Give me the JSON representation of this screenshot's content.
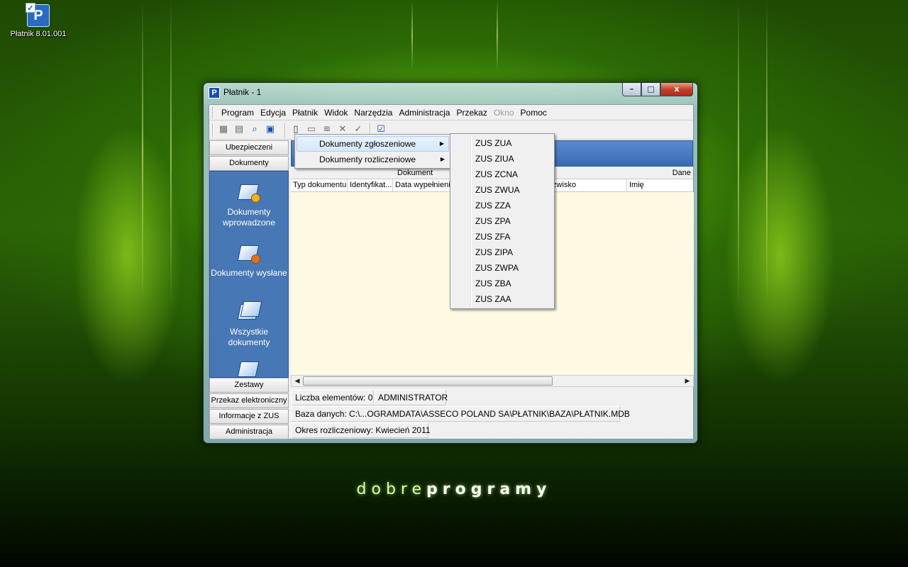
{
  "desktop": {
    "icon_label": "Płatnik 8.01.001",
    "brand_light": "dobre",
    "brand_bold": "programy"
  },
  "window": {
    "title": "Płatnik - 1",
    "controls": {
      "minimize": "–",
      "maximize": "□",
      "close": "x"
    }
  },
  "menu": [
    "Program",
    "Edycja",
    "Płatnik",
    "Widok",
    "Narzędzia",
    "Administracja",
    "Przekaz",
    "Okno",
    "Pomoc"
  ],
  "menu_disabled": "Okno",
  "nav": {
    "top_tabs": [
      "Ubezpieczeni",
      "Dokumenty"
    ],
    "items": [
      "Dokumenty wprowadzone",
      "Dokumenty wysłane",
      "Wszystkie dokumenty"
    ],
    "scroll_glyph": "▼",
    "bottom_tabs": [
      "Zestawy",
      "Przekaz elektroniczny",
      "Informacje z ZUS",
      "Administracja"
    ]
  },
  "grid": {
    "group_document": "Dokument",
    "group_data": "Dane",
    "columns": [
      "Typ dokumentu",
      "Identyfikat...",
      "Data wypełnienia",
      "",
      "Nazwisko",
      "Imię"
    ]
  },
  "status": {
    "count": "Liczba elementów: 0",
    "user": "ADMINISTRATOR",
    "database": "Baza danych: C:\\...OGRAMDATA\\ASSECO POLAND SA\\PŁATNIK\\BAZA\\PŁATNIK.MDB",
    "period": "Okres rozliczeniowy: Kwiecień 2011"
  },
  "context_menu": {
    "items": [
      "Dokumenty zgłoszeniowe",
      "Dokumenty rozliczeniowe"
    ],
    "arrow": "▶",
    "submenu": [
      "ZUS ZUA",
      "ZUS ZIUA",
      "ZUS ZCNA",
      "ZUS ZWUA",
      "ZUS ZZA",
      "ZUS ZPA",
      "ZUS ZFA",
      "ZUS ZIPA",
      "ZUS ZWPA",
      "ZUS ZBA",
      "ZUS ZAA"
    ]
  },
  "colors": {
    "panel_blue": "#4777b4",
    "list_bg": "#fdf9e3",
    "close_red": "#c4402c"
  },
  "icons": [
    "print-icon",
    "print-preview-icon",
    "search-icon",
    "report-icon",
    "new-document-icon",
    "folder-icon",
    "send-icon",
    "delete-icon",
    "check-icon",
    "validate-icon"
  ]
}
